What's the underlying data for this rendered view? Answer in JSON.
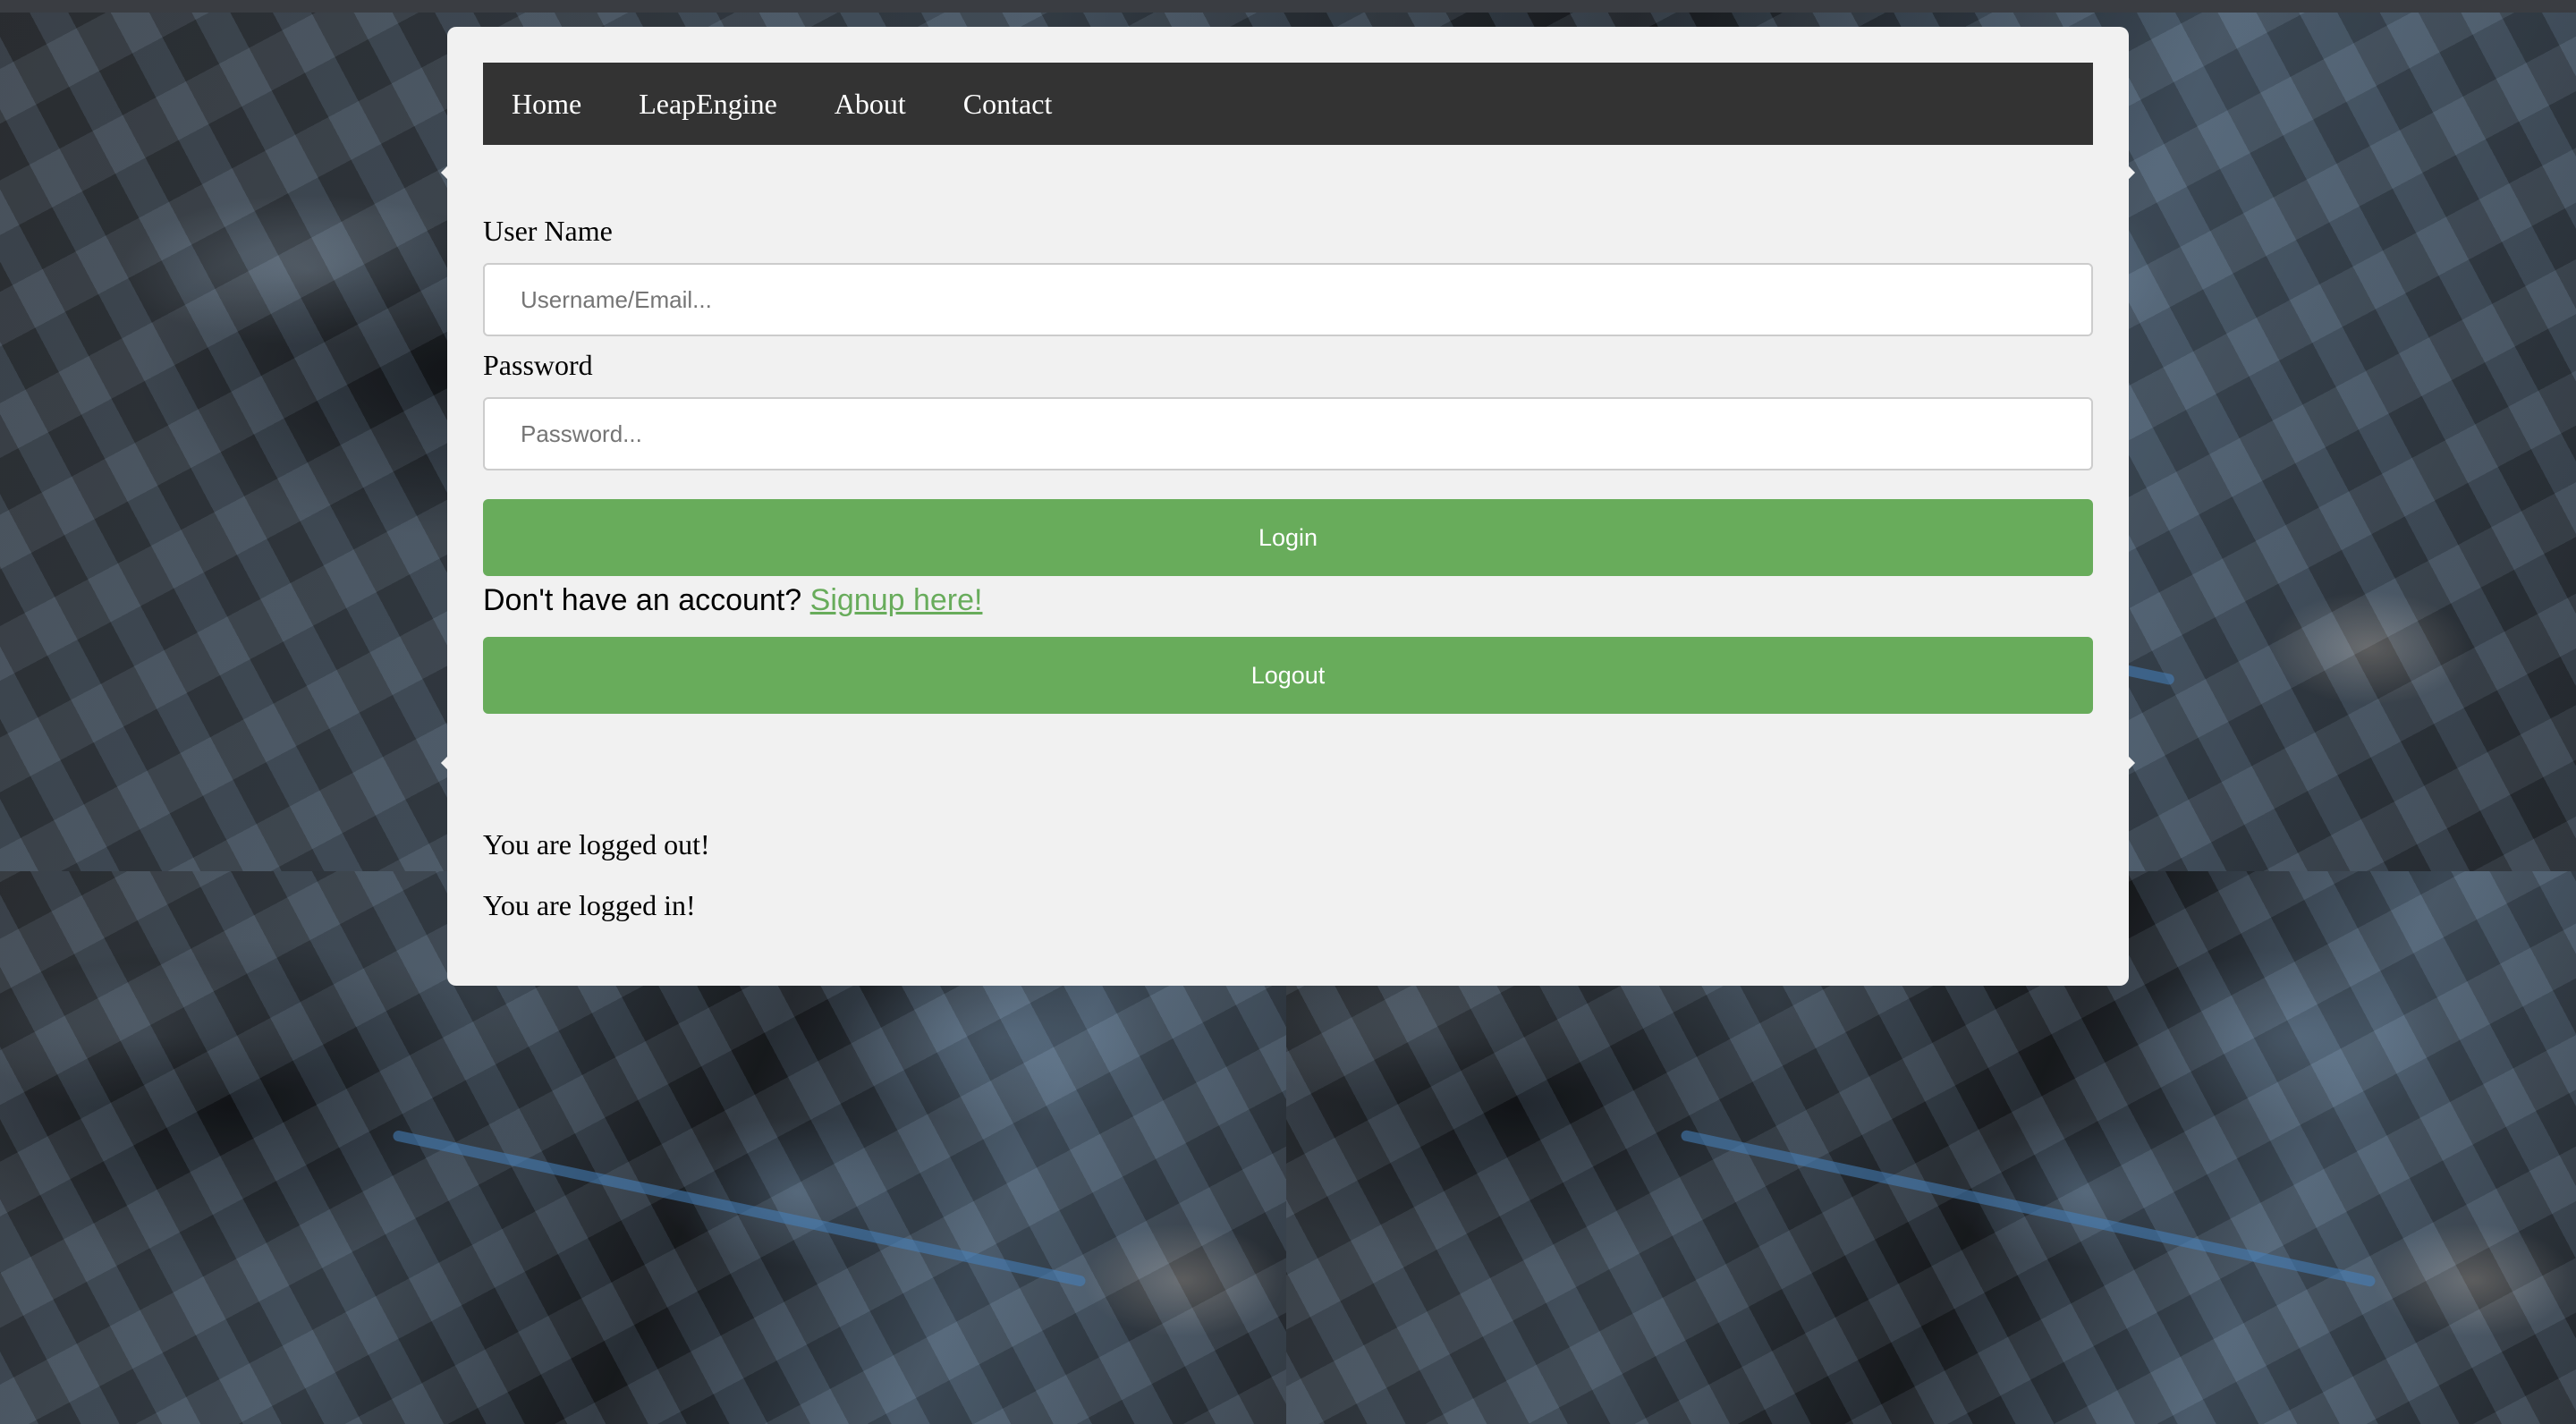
{
  "nav": {
    "items": [
      {
        "label": "Home"
      },
      {
        "label": "LeapEngine"
      },
      {
        "label": "About"
      },
      {
        "label": "Contact"
      }
    ]
  },
  "login_form": {
    "username_label": "User Name",
    "username_placeholder": "Username/Email...",
    "username_value": "",
    "password_label": "Password",
    "password_placeholder": "Password...",
    "password_value": "",
    "login_button": "Login",
    "signup_prompt": "Don't have an account?",
    "signup_link": "Signup here!",
    "logout_button": "Logout"
  },
  "status": {
    "logged_out": "You are logged out!",
    "logged_in": "You are logged in!"
  },
  "colors": {
    "accent_green": "#68ac5b",
    "navbar_bg": "#333333",
    "panel_bg": "#f1f1f1"
  }
}
